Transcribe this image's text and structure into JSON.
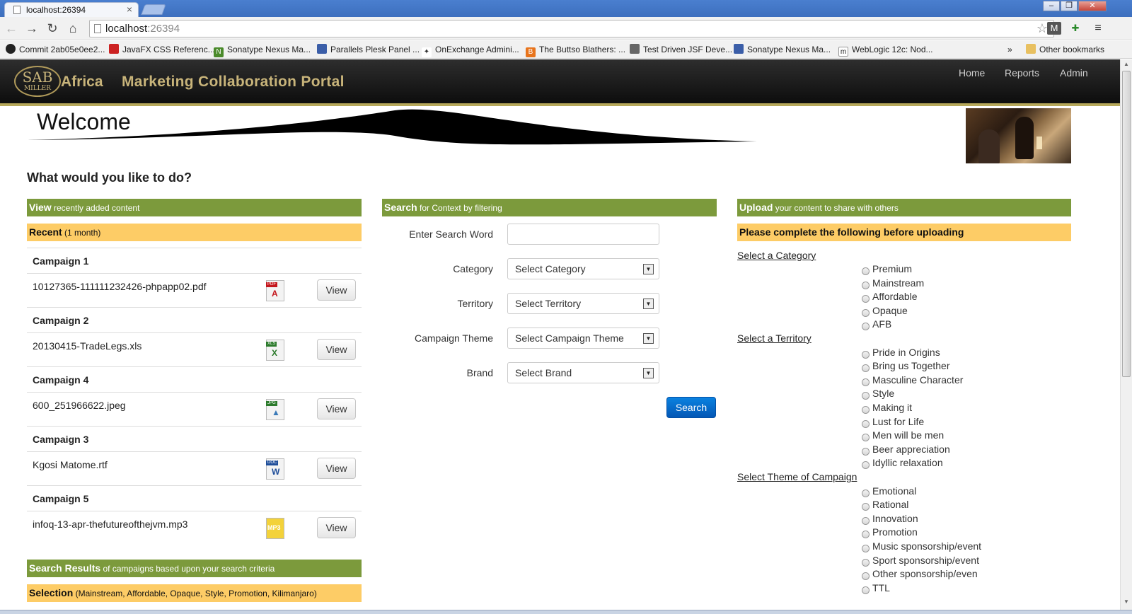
{
  "browser": {
    "tab_title": "localhost:26394",
    "url_host": "localhost",
    "url_port": ":26394",
    "window_controls": [
      "–",
      "❐",
      "✕"
    ],
    "bookmarks": [
      {
        "label": "Commit 2ab05e0ee2...",
        "color": "#222222"
      },
      {
        "label": "JavaFX CSS Referenc...",
        "color": "#cc2222"
      },
      {
        "label": "Sonatype Nexus Ma...",
        "color": "#4a8a2a"
      },
      {
        "label": "Parallels Plesk Panel ...",
        "color": "#3b5ea8"
      },
      {
        "label": "OnExchange Admini...",
        "color": "#555555"
      },
      {
        "label": "The Buttso Blathers: ...",
        "color": "#e8741c"
      },
      {
        "label": "Test Driven JSF Deve...",
        "color": "#555555"
      },
      {
        "label": "Sonatype Nexus Ma...",
        "color": "#3b5ea8"
      },
      {
        "label": "WebLogic 12c: Nod...",
        "color": "#222222"
      }
    ],
    "bookmarks_overflow": "»",
    "other_bookmarks": "Other bookmarks"
  },
  "site": {
    "brand_logo_top": "SAB",
    "brand_logo_bottom": "MILLER",
    "brand_region": "Africa",
    "brand_title": "Marketing Collaboration Portal",
    "nav": [
      "Home",
      "Reports",
      "Admin"
    ]
  },
  "page": {
    "welcome": "Welcome",
    "question": "What would you like to do?"
  },
  "view": {
    "header_bold": "View",
    "header_rest": " recently added content",
    "recent_bold": "Recent",
    "recent_rest": " (1 month)",
    "button_label": "View",
    "campaigns": [
      {
        "title": "Campaign 1",
        "file": "10127365-111111232426-phpapp02.pdf",
        "type": "PDF"
      },
      {
        "title": "Campaign 2",
        "file": "20130415-TradeLegs.xls",
        "type": "XLS"
      },
      {
        "title": "Campaign 4",
        "file": "600_251966622.jpeg",
        "type": "JPG"
      },
      {
        "title": "Campaign 3",
        "file": "Kgosi Matome.rtf",
        "type": "DOC"
      },
      {
        "title": "Campaign 5",
        "file": "infoq-13-apr-thefutureofthejvm.mp3",
        "type": "MP3"
      }
    ],
    "results_bold": "Search Results",
    "results_rest": " of campaigns based upon your search criteria",
    "selection_bold": "Selection",
    "selection_rest": " (Mainstream, Affordable, Opaque, Style, Promotion, Kilimanjaro)"
  },
  "search": {
    "header_bold": "Search",
    "header_rest": " for Context by filtering",
    "word_label": "Enter Search Word",
    "word_value": "",
    "category_label": "Category",
    "category_value": "Select Category",
    "territory_label": "Territory",
    "territory_value": "Select Territory",
    "theme_label": "Campaign Theme",
    "theme_value": "Select Campaign Theme",
    "brand_label": "Brand",
    "brand_value": "Select Brand",
    "button": "Search"
  },
  "upload": {
    "header_bold": "Upload",
    "header_rest": " your content to share with others",
    "notice": "Please complete the following before uploading",
    "category_link": "Select a Category",
    "categories": [
      "Premium",
      "Mainstream",
      "Affordable",
      "Opaque",
      "AFB"
    ],
    "territory_link": "Select a Territory",
    "territories": [
      "Pride in Origins",
      "Bring us Together",
      "Masculine Character",
      "Style",
      "Making it",
      "Lust for Life",
      "Men will be men",
      "Beer appreciation",
      "Idyllic relaxation"
    ],
    "theme_link": "Select Theme of Campaign",
    "themes": [
      "Emotional",
      "Rational",
      "Innovation",
      "Promotion",
      "Music sponsorship/event",
      "Sport sponsorship/event",
      "Other sponsorship/even",
      "TTL"
    ]
  },
  "colors": {
    "header_green": "#7c9a3c",
    "sub_orange": "#fdcc66",
    "brand_gold": "#c8b47a",
    "primary_blue": "#0457b5"
  }
}
